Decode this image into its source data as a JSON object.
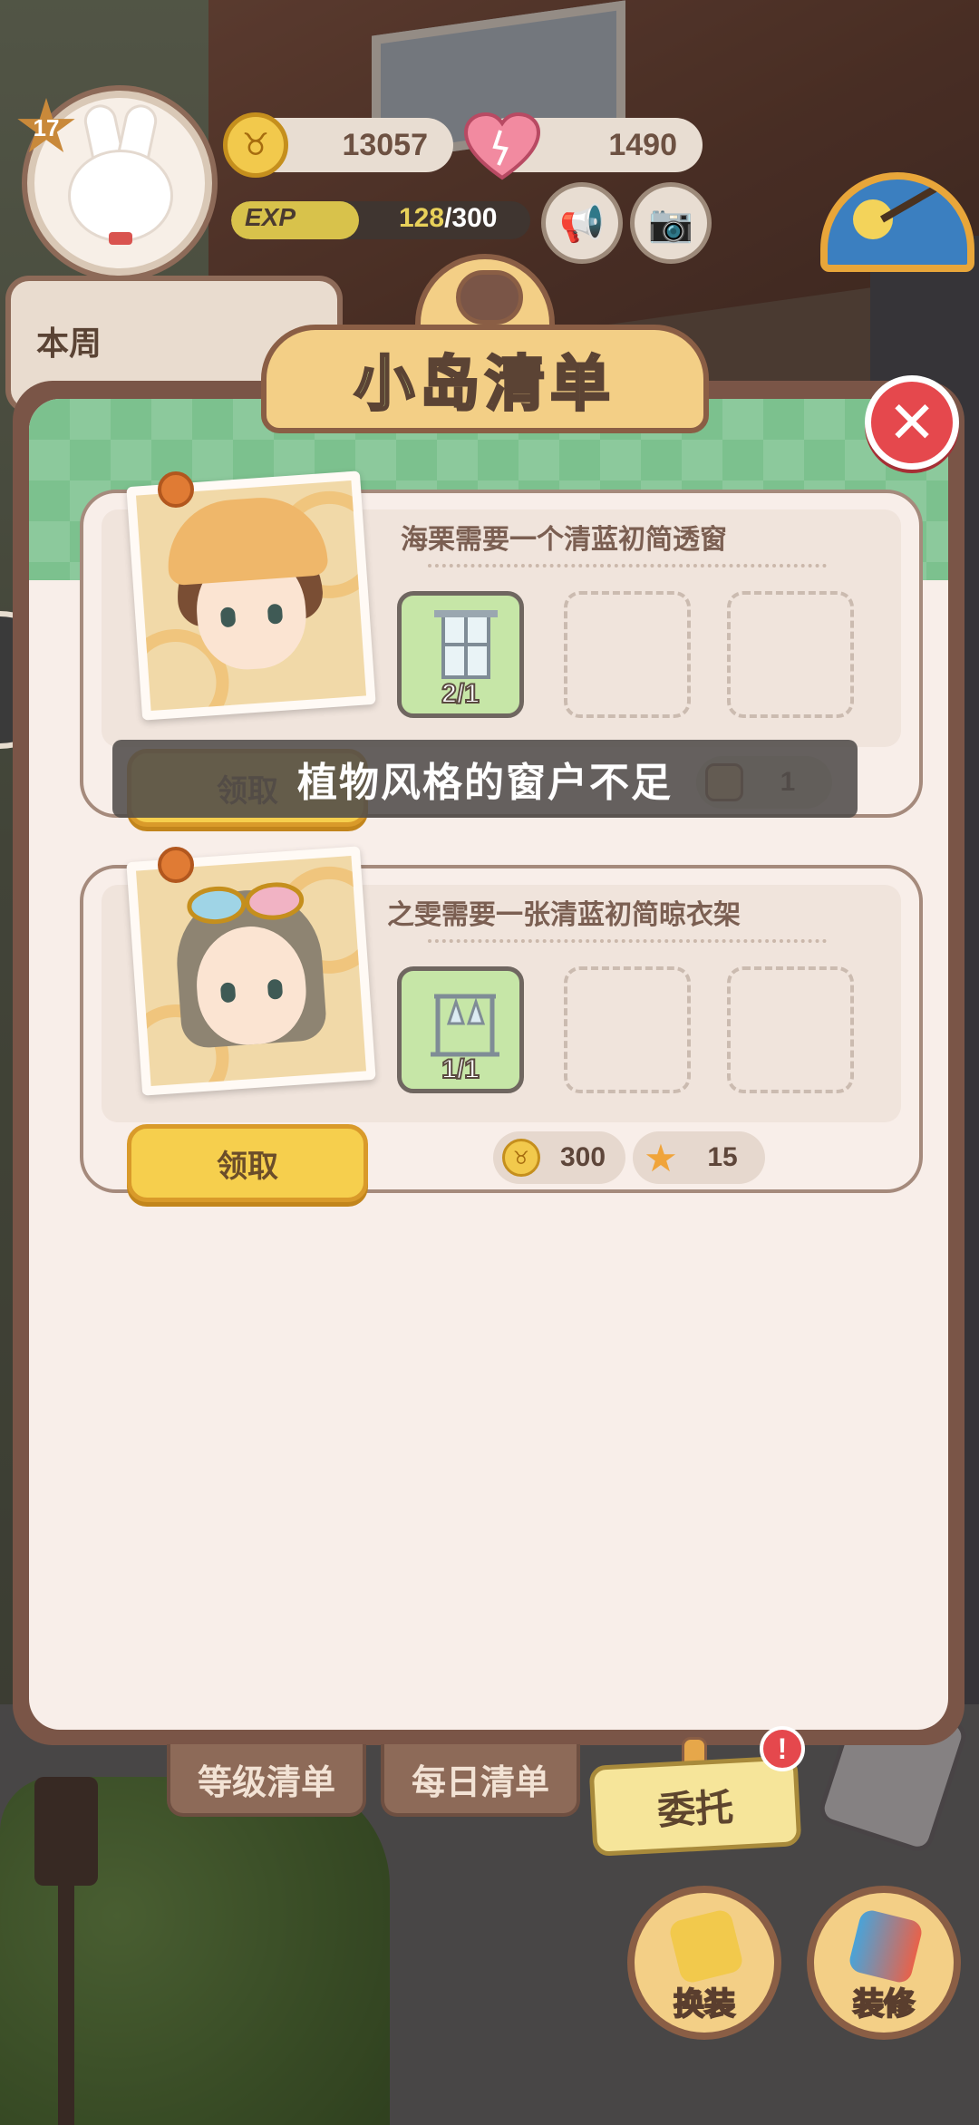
{
  "hud": {
    "level": "17",
    "coins": "13057",
    "hearts": "1490",
    "exp_label": "EXP",
    "exp_current": "128",
    "exp_max": "/300",
    "exp_progress": 0.4267
  },
  "weekly": {
    "label": "本周"
  },
  "panel": {
    "title": "小岛清单",
    "close_icon": "close-icon"
  },
  "tasks": [
    {
      "title": "海栗需要一个清蓝初简透窗",
      "slot_count": "2/1",
      "claim_label": "领取",
      "rewards": [
        {
          "icon": "storage-box-icon",
          "value": "1"
        }
      ]
    },
    {
      "title": "之雯需要一张清蓝初简晾衣架",
      "slot_count": "1/1",
      "claim_label": "领取",
      "rewards": [
        {
          "icon": "coin-icon",
          "value": "300"
        },
        {
          "icon": "star-icon",
          "value": "15"
        }
      ]
    }
  ],
  "toast": "植物风格的窗户不足",
  "tabs": {
    "level_list": "等级清单",
    "daily_list": "每日清单",
    "commission": "委托",
    "commission_badge": "!"
  },
  "actions": {
    "dress_up": "换装",
    "decorate": "装修"
  },
  "colors": {
    "panel_frame": "#7a5547",
    "claim_button": "#f6cf4d",
    "close_button": "#e5484d",
    "header_green": "#7cc18e"
  }
}
